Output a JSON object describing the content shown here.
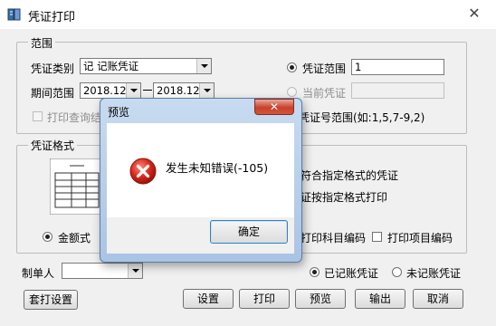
{
  "window": {
    "title": "凭证打印",
    "close_glyph": "✕"
  },
  "range_group": {
    "legend": "范围",
    "voucher_type_label": "凭证类别",
    "voucher_type_value": "记    记账凭证",
    "period_label": "期间范围",
    "period_start": "2018.12",
    "period_end": "2018.12",
    "print_query_label": "打印查询结",
    "voucher_range_label": "凭证范围",
    "voucher_range_value": "1",
    "current_voucher_label": "当前凭证",
    "range_hint": "凭证号范围(如:1,5,7-9,2)"
  },
  "format_group": {
    "legend": "凭证格式",
    "amount_format_label": "金额式",
    "match_format_text": "符合指定格式的凭证",
    "print_format_text": "证按指定格式打印",
    "print_subject_code_label": "打印科目编码",
    "print_item_code_label": "打印项目编码"
  },
  "bottom": {
    "maker_label": "制单人",
    "maker_value": "",
    "posted_label": "已记账凭证",
    "unposted_label": "未记账凭证"
  },
  "buttons": {
    "template_setup": "套打设置",
    "settings": "设置",
    "print": "打印",
    "preview": "预览",
    "export": "输出",
    "cancel": "取消"
  },
  "modal": {
    "title": "预览",
    "close_glyph": "✕",
    "message": "发生未知错误(-105)",
    "ok_label": "确定",
    "icon": "error-icon"
  },
  "colors": {
    "error_red": "#d9261c",
    "modal_frame": "#a9c4e4"
  }
}
